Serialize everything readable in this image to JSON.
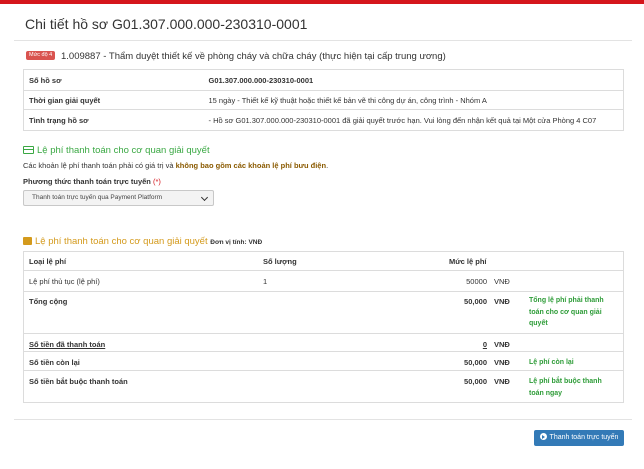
{
  "page": {
    "title": "Chi tiết hồ sơ G01.307.000.000-230310-0001"
  },
  "procedure": {
    "level_badge": "Mức độ 4",
    "title": "1.009887 - Thẩm duyệt thiết kế về phòng cháy và chữa cháy (thực hiện tại cấp trung ương)"
  },
  "info": {
    "rows": [
      {
        "label": "Số hồ sơ",
        "value": "G01.307.000.000-230310-0001"
      },
      {
        "label": "Thời gian giải quyết",
        "value": "15 ngày - Thiết kế kỹ thuật hoặc thiết kế bản vẽ thi công dự án, công trình - Nhóm A"
      },
      {
        "label": "Tình trạng hồ sơ",
        "value": "- Hồ sơ G01.307.000.000-230310-0001 đã giải quyết trước hạn. Vui lòng đến nhận kết quả tại Một cửa Phòng 4 C07"
      }
    ]
  },
  "payment": {
    "section_title": "Lệ phí thanh toán cho cơ quan giải quyết",
    "note_prefix": "Các khoản lệ phí thanh toán phải có giá trị và ",
    "note_bold": "không bao gồm các khoản lệ phí bưu điện",
    "note_suffix": ".",
    "method_label": "Phương thức thanh toán trực tuyến",
    "method_required": "(*)",
    "method_selected": "Thanh toán trực tuyến qua Payment Platform"
  },
  "fees": {
    "section_title": "Lệ phí thanh toán cho cơ quan giải quyết",
    "unit": "Đơn vị tính: VNĐ",
    "headers": {
      "type": "Loại lệ phí",
      "qty": "Số lượng",
      "amount": "Mức lệ phí"
    },
    "item": {
      "type": "Lệ phí thủ tục (lệ phí)",
      "qty": "1",
      "amount": "50000",
      "currency": "VNĐ"
    },
    "total": {
      "label": "Tổng cộng",
      "amount": "50,000",
      "currency": "VNĐ",
      "note": "Tổng lệ phí phải thanh toán cho cơ quan giải quyết"
    },
    "paid": {
      "label": "Số tiền đã thanh toán",
      "amount": "0",
      "currency": "VNĐ"
    },
    "remaining": {
      "label": "Số tiền còn lại",
      "amount": "50,000",
      "currency": "VNĐ",
      "note": "Lệ phí còn lại"
    },
    "required": {
      "label": "Số tiền bắt buộc thanh toán",
      "amount": "50,000",
      "currency": "VNĐ",
      "note": "Lệ phí bắt buộc thanh toán ngay"
    }
  },
  "actions": {
    "pay_online": "Thanh toán trực tuyến"
  },
  "colors": {
    "top_bar": "#d5161c",
    "badge": "#d9534f",
    "code_red": "#b7312c",
    "link_blue": "#2a7ab0",
    "green": "#3aa843",
    "orange": "#d49a1c",
    "button": "#337ab7"
  },
  "icons": {
    "payment_section": "credit-card-icon",
    "fee_section": "money-icon",
    "pay_button": "arrow-circle-right-icon",
    "select": "chevron-down-icon"
  }
}
